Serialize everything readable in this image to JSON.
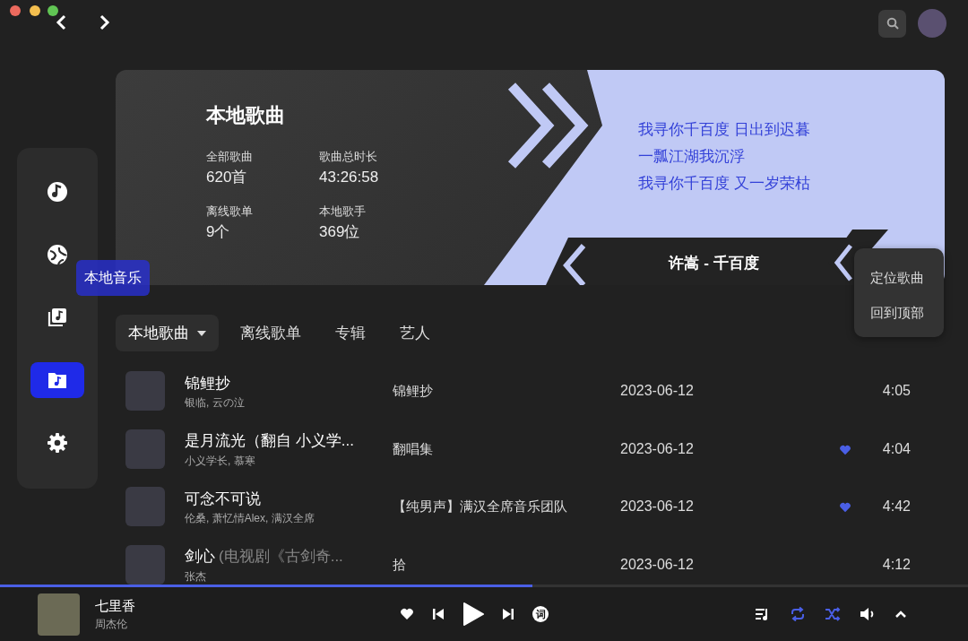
{
  "sidebar": {
    "items": [
      {
        "kind": "disc",
        "selected": false
      },
      {
        "kind": "planet",
        "selected": false
      },
      {
        "kind": "library",
        "selected": false
      },
      {
        "kind": "folder",
        "selected": true
      },
      {
        "kind": "settings",
        "selected": false
      }
    ],
    "tooltip": "本地音乐"
  },
  "banner": {
    "title": "本地歌曲",
    "stats": [
      {
        "label": "全部歌曲",
        "value": "620首"
      },
      {
        "label": "歌曲总时长",
        "value": "43:26:58"
      },
      {
        "label": "离线歌单",
        "value": "9个"
      },
      {
        "label": "本地歌手",
        "value": "369位"
      }
    ],
    "lyrics": [
      "我寻你千百度 日出到迟暮",
      "一瓢江湖我沉浮",
      "我寻你千百度 又一岁荣枯"
    ],
    "now_playing": "许嵩 - 千百度"
  },
  "tabs": [
    {
      "label": "本地歌曲",
      "selected": true,
      "dropdown": true
    },
    {
      "label": "离线歌单",
      "selected": false,
      "dropdown": false
    },
    {
      "label": "专辑",
      "selected": false,
      "dropdown": false
    },
    {
      "label": "艺人",
      "selected": false,
      "dropdown": false
    }
  ],
  "menu": {
    "items": [
      "定位歌曲",
      "回到顶部"
    ]
  },
  "songs": [
    {
      "title": "锦鲤抄",
      "artists": "银临, 云の泣",
      "album": "锦鲤抄",
      "date": "2023-06-12",
      "liked": false,
      "duration": "4:05"
    },
    {
      "title": "是月流光（翻自 小义学...",
      "artists": "小义学长, 慕寒",
      "album": "翻唱集",
      "date": "2023-06-12",
      "liked": true,
      "duration": "4:04"
    },
    {
      "title": "可念不可说",
      "artists": "伦桑, 萧忆情Alex, 满汉全席",
      "album": "【纯男声】满汉全席音乐团队",
      "date": "2023-06-12",
      "liked": true,
      "duration": "4:42"
    },
    {
      "title": "剑心",
      "title_note": "(电视剧《古剑奇...",
      "artists": "张杰",
      "album": "拾",
      "date": "2023-06-12",
      "liked": false,
      "duration": "4:12"
    }
  ],
  "player": {
    "progress": {
      "level": 0.55
    },
    "title": "七里香",
    "artist": "周杰伦",
    "lyrics_button": "词",
    "repeat": true,
    "shuffle": true
  }
}
